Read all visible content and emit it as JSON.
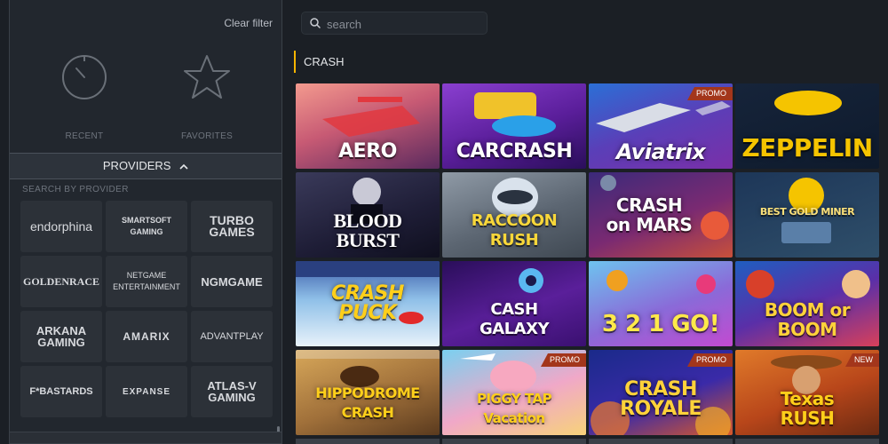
{
  "filter": {
    "clear_label": "Clear filter",
    "recent_label": "RECENT",
    "favorites_label": "FAVORITES",
    "providers_label": "PROVIDERS",
    "search_by_label": "SEARCH BY PROVIDER"
  },
  "providers": [
    {
      "name": "endorphina"
    },
    {
      "name": "SMARTSOFT GAMING"
    },
    {
      "name": "TURBO GAMES"
    },
    {
      "name": "GOLDENRACE"
    },
    {
      "name": "NETGAME ENTERTAINMENT"
    },
    {
      "name": "NGMGAME"
    },
    {
      "name": "ARKANA GAMING"
    },
    {
      "name": "AMARIX"
    },
    {
      "name": "ADVANTPLAY"
    },
    {
      "name": "F*BASTARDS"
    },
    {
      "name": "EXPANSE"
    },
    {
      "name": "ATLAS-V GAMING"
    }
  ],
  "search": {
    "placeholder": "search"
  },
  "category": {
    "title": "CRASH"
  },
  "games": [
    {
      "name": "AERO",
      "badge": "",
      "bg": "linear-gradient(160deg,#f39a8e 0%,#c75a74 45%,#5a2a5e 100%)"
    },
    {
      "name": "CARCRASH",
      "badge": "",
      "bg": "linear-gradient(160deg,#8a3fd0 0%,#5a1e9a 55%,#2a0e5a 100%)"
    },
    {
      "name": "Aviatrix",
      "badge": "PROMO",
      "bg": "linear-gradient(160deg,#2b6fd6 0%,#5a3fb8 50%,#7a2fa8 100%)"
    },
    {
      "name": "ZEPPELIN",
      "badge": "",
      "bg": "linear-gradient(160deg,#16243a 0%,#0e1a2c 100%)"
    },
    {
      "name": "BLOOD BURST",
      "badge": "",
      "bg": "linear-gradient(160deg,#3a3a5a 0%,#1e1d36 60%,#0f0f1e 100%)"
    },
    {
      "name": "RACCOON RUSH",
      "badge": "",
      "bg": "linear-gradient(160deg,#8f9aa6 0%,#5c6672 55%,#3f4852 100%)"
    },
    {
      "name": "CRASH on MARS",
      "badge": "",
      "bg": "linear-gradient(160deg,#3b2a7a 0%,#7a2a72 55%,#c8503a 100%)"
    },
    {
      "name": "BEST GOLD MINER",
      "badge": "",
      "bg": "linear-gradient(160deg,#1d3658 0%,#2f4f6a 100%)"
    },
    {
      "name": "CRASH PUCK",
      "badge": "",
      "bg": "linear-gradient(180deg,#3a5aa8 0%,#8fc0e8 45%,#e8f2fa 100%)"
    },
    {
      "name": "CASH GALAXY",
      "badge": "",
      "bg": "linear-gradient(160deg,#2a0e5a 0%,#5a1f9a 55%,#3a1070 100%)"
    },
    {
      "name": "3 2 1 GO!",
      "badge": "",
      "bg": "linear-gradient(160deg,#6ec3ef 0%,#8a6ad8 55%,#c24ad0 100%)"
    },
    {
      "name": "BOOM or BOOM",
      "badge": "",
      "bg": "linear-gradient(160deg,#1f5ec0 0%,#5a2fa8 50%,#d8405a 100%)"
    },
    {
      "name": "HIPPODROME CRASH",
      "badge": "",
      "bg": "linear-gradient(160deg,#d8a85a 0%,#a0703a 55%,#5a3a1e 100%)"
    },
    {
      "name": "PIGGY TAP Vacation",
      "badge": "PROMO",
      "bg": "linear-gradient(160deg,#7ad0f0 0%,#f0a8c8 55%,#f7d27a 100%)"
    },
    {
      "name": "CRASH ROYALE",
      "badge": "PROMO",
      "bg": "linear-gradient(160deg,#1a2a8a 0%,#3a2aa8 55%,#d8582a 100%)"
    },
    {
      "name": "Texas RUSH",
      "badge": "NEW",
      "bg": "linear-gradient(160deg,#e07a2a 0%,#b8461a 55%,#6a2a12 100%)"
    }
  ]
}
